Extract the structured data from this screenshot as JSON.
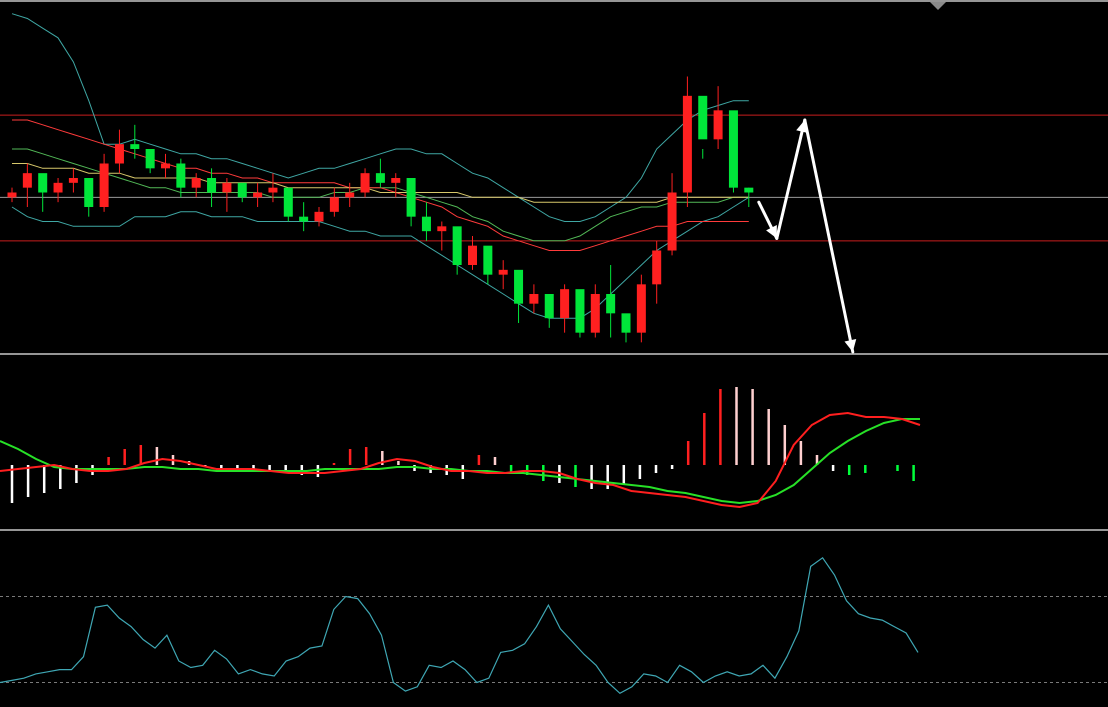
{
  "chart_data": [
    {
      "type": "candlestick",
      "pane": "price",
      "levels": {
        "resistance": 59.0,
        "mid": 42.0,
        "support": 33.0
      },
      "bollinger": {
        "upper": [
          80,
          79,
          77,
          75,
          70,
          62,
          53,
          53,
          54,
          53,
          52,
          51,
          51,
          50,
          50,
          49,
          48,
          47,
          46,
          47,
          48,
          48,
          49,
          50,
          51,
          52,
          52,
          51,
          51,
          49,
          47,
          46,
          44,
          42,
          40,
          38,
          37,
          37,
          38,
          40,
          42,
          46,
          52,
          55,
          58,
          60,
          61,
          62,
          62
        ],
        "middle": [
          52,
          52,
          51,
          50,
          49,
          48,
          47,
          46,
          45,
          44,
          44,
          43,
          43,
          43,
          43,
          43,
          43,
          42,
          42,
          42,
          42,
          43,
          43,
          44,
          44,
          44,
          43,
          42,
          41,
          40,
          38,
          37,
          35,
          34,
          33,
          33,
          33,
          34,
          36,
          38,
          39,
          40,
          40,
          41,
          41,
          41,
          41,
          42,
          42
        ],
        "lower": [
          40,
          38,
          37,
          37,
          36,
          36,
          36,
          36,
          38,
          38,
          38,
          39,
          39,
          38,
          38,
          38,
          37,
          37,
          37,
          37,
          37,
          36,
          35,
          35,
          34,
          34,
          34,
          32,
          30,
          28,
          26,
          24,
          22,
          20,
          18,
          17,
          17,
          17,
          19,
          22,
          25,
          28,
          31,
          33,
          35,
          37,
          38,
          40,
          42
        ]
      },
      "moving_averages": [
        {
          "name": "",
          "color": "#ff3b3b",
          "values": [
            58,
            58,
            57,
            56,
            55,
            54,
            53,
            52,
            51,
            50,
            49,
            48,
            48,
            47,
            47,
            46,
            46,
            45,
            45,
            45,
            45,
            45,
            44,
            44,
            44,
            43,
            42,
            41,
            40,
            38,
            37,
            36,
            34,
            33,
            32,
            31,
            31,
            31,
            32,
            33,
            34,
            35,
            36,
            36,
            37,
            37,
            37,
            37,
            37
          ]
        },
        {
          "name": "",
          "color": "#d7c86b",
          "values": [
            49,
            49,
            48,
            48,
            48,
            47,
            47,
            47,
            46,
            46,
            46,
            46,
            46,
            45,
            45,
            45,
            45,
            45,
            44,
            44,
            44,
            44,
            44,
            44,
            43,
            43,
            43,
            43,
            43,
            43,
            42,
            42,
            42,
            42,
            41,
            41,
            41,
            41,
            41,
            41,
            41,
            41,
            41,
            42,
            42,
            42,
            42,
            42,
            42
          ]
        }
      ],
      "candles": [
        [
          42,
          44,
          41,
          43
        ],
        [
          44,
          49,
          40,
          47
        ],
        [
          47,
          45,
          39,
          43
        ],
        [
          43,
          46,
          41,
          45
        ],
        [
          45,
          48,
          43,
          46
        ],
        [
          46,
          43,
          38,
          40
        ],
        [
          40,
          51,
          39,
          49
        ],
        [
          49,
          56,
          47,
          53
        ],
        [
          53,
          57,
          50,
          52
        ],
        [
          52,
          50,
          47,
          48
        ],
        [
          48,
          51,
          46,
          49
        ],
        [
          49,
          50,
          42,
          44
        ],
        [
          44,
          47,
          42,
          46
        ],
        [
          46,
          48,
          40,
          43
        ],
        [
          43,
          46,
          39,
          45
        ],
        [
          45,
          43,
          41,
          42
        ],
        [
          42,
          45,
          40,
          43
        ],
        [
          43,
          47,
          41,
          44
        ],
        [
          44,
          41,
          37,
          38
        ],
        [
          38,
          41,
          35,
          37
        ],
        [
          37,
          40,
          36,
          39
        ],
        [
          39,
          44,
          38,
          42
        ],
        [
          42,
          45,
          40,
          43
        ],
        [
          43,
          48,
          42,
          47
        ],
        [
          47,
          50,
          44,
          45
        ],
        [
          45,
          47,
          42,
          46
        ],
        [
          46,
          44,
          36,
          38
        ],
        [
          38,
          41,
          33,
          35
        ],
        [
          35,
          37,
          31,
          36
        ],
        [
          36,
          30,
          26,
          28
        ],
        [
          28,
          34,
          27,
          32
        ],
        [
          32,
          31,
          24,
          26
        ],
        [
          26,
          29,
          23,
          27
        ],
        [
          27,
          22,
          16,
          20
        ],
        [
          20,
          24,
          18,
          22
        ],
        [
          22,
          18,
          15,
          17
        ],
        [
          17,
          24,
          14,
          23
        ],
        [
          23,
          20,
          13,
          14
        ],
        [
          14,
          24,
          13,
          22
        ],
        [
          22,
          28,
          13,
          18
        ],
        [
          18,
          16,
          12,
          14
        ],
        [
          14,
          26,
          12,
          24
        ],
        [
          24,
          33,
          20,
          31
        ],
        [
          31,
          47,
          30,
          43
        ],
        [
          43,
          67,
          40,
          63
        ],
        [
          63,
          52,
          50,
          54
        ],
        [
          54,
          65,
          52,
          60
        ],
        [
          60,
          48,
          43,
          44
        ],
        [
          44,
          44,
          40,
          43
        ]
      ]
    },
    {
      "type": "macd",
      "pane": "macd",
      "histogram": [
        -1.9,
        -1.6,
        -1.4,
        -1.2,
        -0.9,
        -0.5,
        0.4,
        0.8,
        1.0,
        0.9,
        0.5,
        0.2,
        -0.1,
        -0.2,
        -0.2,
        -0.3,
        -0.3,
        -0.4,
        -0.5,
        -0.6,
        0.1,
        0.8,
        0.9,
        0.7,
        0.2,
        -0.3,
        -0.4,
        -0.5,
        -0.7,
        0.5,
        0.4,
        -0.4,
        -0.5,
        -0.8,
        -0.9,
        -1.1,
        -1.2,
        -1.2,
        -1.0,
        -0.7,
        -0.4,
        -0.2,
        1.2,
        2.6,
        3.8,
        3.9,
        3.8,
        2.8,
        2.0,
        1.2,
        0.5,
        -0.3,
        -0.5,
        -0.4,
        0.0,
        -0.3,
        -0.8
      ],
      "histogram_colors": [
        "#ffffff",
        "#ffffff",
        "#ffffff",
        "#ffffff",
        "#ffffff",
        "#ffffff",
        "#ff2020",
        "#ff2020",
        "#ff2020",
        "#ffd0d0",
        "#ffd0d0",
        "#ffd0d0",
        "#ffffff",
        "#ffffff",
        "#ffffff",
        "#ffffff",
        "#ffffff",
        "#ffffff",
        "#ffffff",
        "#ffffff",
        "#ff2020",
        "#ff2020",
        "#ff2020",
        "#ffd0d0",
        "#ffd0d0",
        "#ffffff",
        "#ffffff",
        "#ffffff",
        "#ffffff",
        "#ff2020",
        "#ffd0d0",
        "#00ff3a",
        "#00ff3a",
        "#00ff3a",
        "#ffffff",
        "#00ff3a",
        "#ffffff",
        "#ffffff",
        "#ffffff",
        "#ffffff",
        "#ffffff",
        "#ffffff",
        "#ff2020",
        "#ff2020",
        "#ff2020",
        "#ffd0d0",
        "#ffd0d0",
        "#ffd0d0",
        "#ffd0d0",
        "#ffd0d0",
        "#ffd0d0",
        "#ffffff",
        "#00ff3a",
        "#00ff3a",
        "#ffffff",
        "#00ff3a",
        "#00ff3a"
      ],
      "macd_line": [
        -0.3,
        -0.2,
        -0.1,
        0.0,
        -0.2,
        -0.3,
        -0.3,
        -0.2,
        0.1,
        0.3,
        0.2,
        0.0,
        -0.2,
        -0.2,
        -0.2,
        -0.3,
        -0.4,
        -0.4,
        -0.4,
        -0.3,
        -0.2,
        0.1,
        0.3,
        0.2,
        -0.1,
        -0.3,
        -0.3,
        -0.4,
        -0.4,
        -0.3,
        -0.3,
        -0.4,
        -0.7,
        -0.9,
        -1.0,
        -1.3,
        -1.4,
        -1.5,
        -1.6,
        -1.8,
        -2.0,
        -2.1,
        -1.9,
        -0.8,
        1.0,
        2.0,
        2.5,
        2.6,
        2.4,
        2.4,
        2.3,
        2.0
      ],
      "signal_line": [
        1.2,
        0.8,
        0.3,
        -0.1,
        -0.2,
        -0.2,
        -0.2,
        -0.2,
        -0.1,
        -0.1,
        -0.2,
        -0.2,
        -0.3,
        -0.3,
        -0.3,
        -0.3,
        -0.3,
        -0.3,
        -0.2,
        -0.2,
        -0.2,
        -0.2,
        -0.1,
        -0.1,
        -0.2,
        -0.2,
        -0.3,
        -0.3,
        -0.4,
        -0.4,
        -0.5,
        -0.6,
        -0.7,
        -0.8,
        -0.9,
        -1.0,
        -1.1,
        -1.3,
        -1.4,
        -1.6,
        -1.8,
        -1.9,
        -1.8,
        -1.5,
        -1.0,
        -0.2,
        0.6,
        1.2,
        1.7,
        2.1,
        2.3,
        2.3
      ]
    },
    {
      "type": "line",
      "pane": "oscillator",
      "levels": [
        70,
        30
      ],
      "ylim": [
        20,
        100
      ],
      "values": [
        30,
        31,
        32,
        34,
        35,
        36,
        36,
        42,
        65,
        66,
        60,
        56,
        50,
        46,
        52,
        40,
        37,
        38,
        45,
        41,
        34,
        36,
        34,
        33,
        40,
        42,
        46,
        47,
        64,
        70,
        69,
        62,
        52,
        30,
        26,
        28,
        38,
        37,
        40,
        36,
        30,
        32,
        44,
        45,
        48,
        56,
        66,
        55,
        49,
        43,
        38,
        30,
        25,
        28,
        34,
        33,
        30,
        38,
        35,
        30,
        33,
        35,
        33,
        34,
        38,
        32,
        42,
        54,
        84,
        88,
        80,
        68,
        62,
        60,
        59,
        56,
        53,
        44
      ]
    }
  ]
}
